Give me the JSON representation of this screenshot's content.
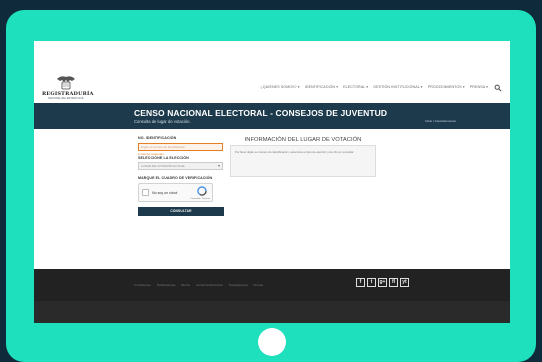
{
  "logo": {
    "name": "REGISTRADURÍA",
    "sub": "NACIONAL DEL ESTADO CIVIL"
  },
  "nav": [
    "¿QUIÉNES SOMOS? ▾",
    "IDENTIFICACIÓN ▾",
    "ELECTORAL ▾",
    "GESTIÓN INSTITUCIONAL ▾",
    "PROCEDIMIENTOS ▾",
    "PRENSA ▾"
  ],
  "banner": {
    "title": "CENSO NACIONAL ELECTORAL - CONSEJOS DE JUVENTUD",
    "subtitle": "Consulta de lugar de votación.",
    "breadcrumb": "Inicio / Consulta Censo"
  },
  "form": {
    "id_label": "NO. IDENTIFICACIÓN",
    "id_placeholder": "Digite el número de identificación",
    "error": "● Campo requerido",
    "election_label": "SELECCIONE LA ELECCIÓN",
    "election_value": "LUGAR DE VOTACIÓN ACTUAL",
    "captcha_label": "MARQUE EL CUADRO DE VERIFICACIÓN",
    "captcha_text": "No soy un robot",
    "captcha_terms": "Privacidad - Términos",
    "submit": "CONSULTAR"
  },
  "info": {
    "title": "INFORMACIÓN DEL LUGAR DE VOTACIÓN",
    "text": "Por favor digite su número de identificación, seleccione el tipo de elección y de clic en consultar."
  },
  "footer": {
    "links": [
      "Contáctenos",
      "Notificaciones",
      "Buzón",
      "Control Institucional",
      "Transparencia",
      "Prensa"
    ],
    "social": [
      "f",
      "t",
      "g+",
      "fl",
      "yt"
    ]
  }
}
